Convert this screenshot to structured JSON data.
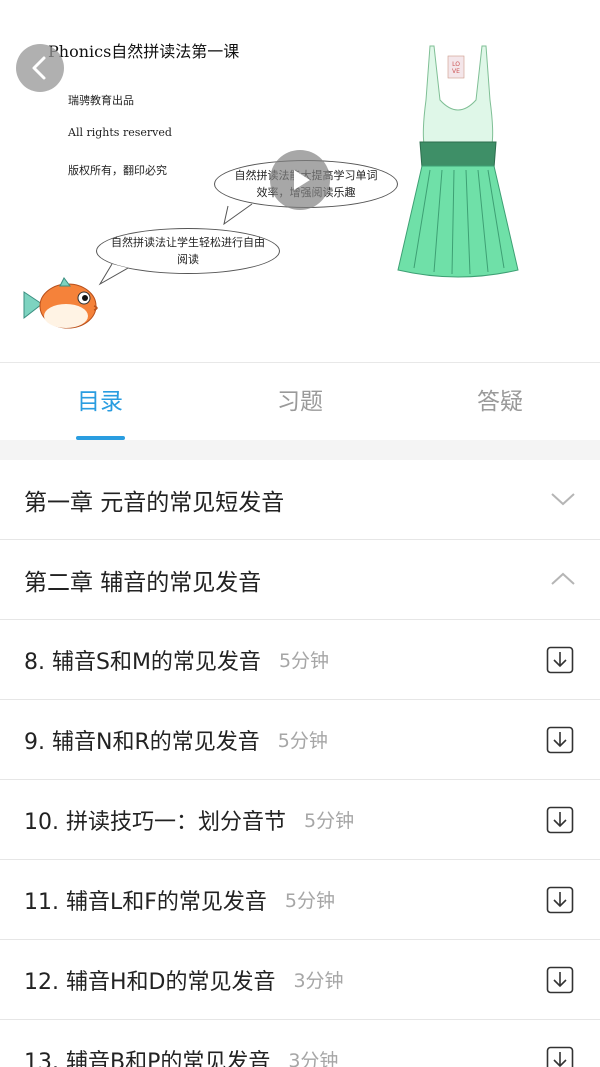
{
  "cover": {
    "title": "Phonics自然拼读法第一课",
    "publisher": "瑞骋教育出品",
    "rights": "All rights reserved",
    "copyright": "版权所有，翻印必究",
    "bubble_top": "自然拼读法能大提高学习单词效率，增强阅读乐趣",
    "bubble_bottom": "自然拼读法让学生轻松进行自由阅读"
  },
  "tabs": {
    "catalog": "目录",
    "exercises": "习题",
    "qa": "答疑",
    "active": "catalog"
  },
  "chapters": [
    {
      "title": "第一章 元音的常见短发音",
      "expanded": false
    },
    {
      "title": "第二章 辅音的常见发音",
      "expanded": true
    }
  ],
  "lessons": [
    {
      "title": "8. 辅音S和M的常见发音",
      "duration": "5分钟"
    },
    {
      "title": "9. 辅音N和R的常见发音",
      "duration": "5分钟"
    },
    {
      "title": "10. 拼读技巧一：划分音节",
      "duration": "5分钟"
    },
    {
      "title": "11. 辅音L和F的常见发音",
      "duration": "5分钟"
    },
    {
      "title": "12. 辅音H和D的常见发音",
      "duration": "3分钟"
    },
    {
      "title": "13. 辅音B和P的常见发音",
      "duration": "3分钟"
    }
  ],
  "colors": {
    "accent": "#2a9de0",
    "muted": "#a6a6a6",
    "divider": "#e6e6e6"
  }
}
